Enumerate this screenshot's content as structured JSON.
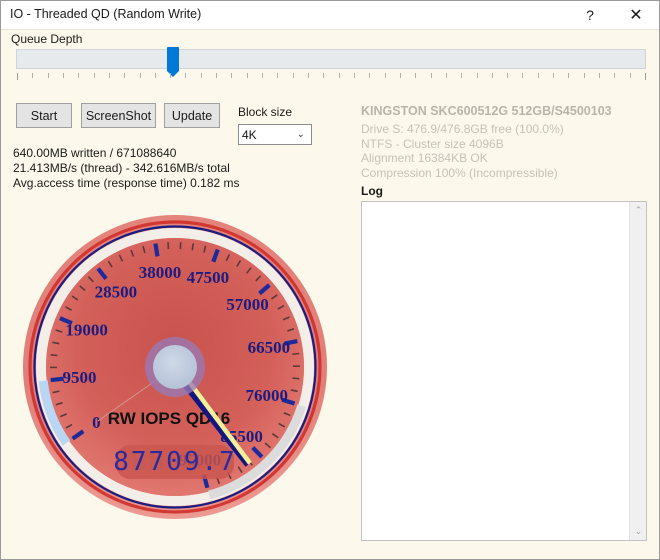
{
  "window": {
    "title": "IO - Threaded QD (Random Write)",
    "help_icon": "?",
    "close_icon": "✕"
  },
  "queue_depth": {
    "label": "Queue Depth",
    "value": 16,
    "ticks": 42
  },
  "toolbar": {
    "start_label": "Start",
    "screenshot_label": "ScreenShot",
    "update_label": "Update"
  },
  "blocksize": {
    "label": "Block size",
    "value": "4K",
    "chevron": "⌄"
  },
  "stats": {
    "lines": [
      "640.00MB written / 671088640",
      "21.413MB/s (thread) - 342.616MB/s total",
      "Avg.access time (response time) 0.182 ms"
    ]
  },
  "drive": {
    "title": "KINGSTON SKC600512G 512GB/S4500103",
    "info_lines": [
      "Drive S: 476.9/476.8GB free (100.0%)",
      "NTFS - Cluster size 4096B",
      "Alignment 16384KB OK",
      "Compression 100% (Incompressible)"
    ]
  },
  "log": {
    "label": "Log",
    "content": "",
    "scroll_up_icon": "⌃",
    "scroll_down_icon": "⌄"
  },
  "chart_data": {
    "type": "gauge",
    "title": "RW IOPS QD16",
    "value": 87709.7,
    "digital_readout": "87709.7",
    "digital_ghost": "88888.8",
    "min": 0,
    "max": 95000,
    "tick_labels": [
      "0",
      "9500",
      "19000",
      "28500",
      "38000",
      "47500",
      "57000",
      "66500",
      "76000",
      "85500",
      "95000"
    ],
    "tick_values": [
      0,
      9500,
      19000,
      28500,
      38000,
      47500,
      57000,
      66500,
      76000,
      85500,
      95000
    ],
    "minor_ticks_per_major": 4,
    "start_angle_deg": 215,
    "sweep_deg": 290,
    "colors": {
      "face": "#d9605a",
      "bezel_outer": "#e8837c",
      "bezel_ring_red": "#cf2f2a",
      "bezel_ring_navy": "#1c1c80",
      "band_low": "#b9d6f2",
      "band_high": "#dcdcdc",
      "needle_top": "#151580",
      "needle_bottom": "#f2f09a",
      "hub": "#bcc9dd",
      "hub_ring": "#9a7ab5",
      "label": "#1c1c80",
      "lcd_on": "#2a2a9e",
      "lcd_off": "#c25a55"
    }
  }
}
